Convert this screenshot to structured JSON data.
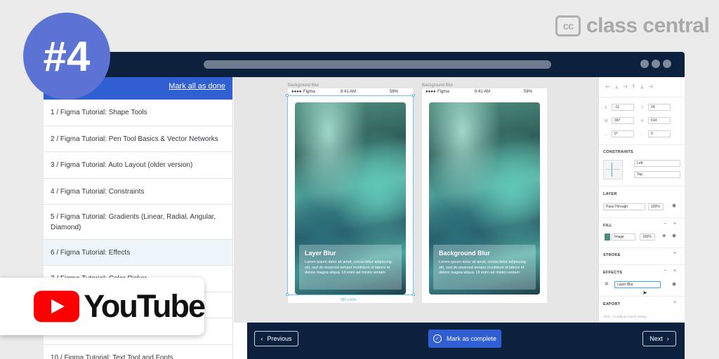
{
  "badge": {
    "text": "#4"
  },
  "brand": {
    "mark": "cc",
    "name": "class central"
  },
  "youtube": {
    "label": "YouTube"
  },
  "sidebar": {
    "mark_all": "Mark all as done",
    "lessons": [
      {
        "label": "1 / Figma Tutorial: Shape Tools"
      },
      {
        "label": "2 / Figma Tutorial: Pen Tool Basics & Vector Networks"
      },
      {
        "label": "3 / Figma Tutorial: Auto Layout (older version)"
      },
      {
        "label": "4 / Figma Tutorial: Constraints"
      },
      {
        "label": "5 / Figma Tutorial: Gradients (Linear, Radial, Angular, Diamond)"
      },
      {
        "label": "6 / Figma Tutorial: Effects",
        "active": true
      },
      {
        "label": "7 / Figma Tutorial: Color Picker"
      },
      {
        "label": ""
      },
      {
        "label": ""
      },
      {
        "label": "10 / Figma Tutorial: Text Tool and Fonts"
      }
    ]
  },
  "canvas": {
    "frames": [
      {
        "label": "Background Blur",
        "carrier": "Figma",
        "time": "9:41 AM",
        "battery": "58%",
        "card_title": "Layer Blur",
        "card_body": "Lorem ipsum dolor sit amet, consectetur adipiscing elit, sed do eiusmod tempor incididunt ut labore et dolore magna aliqua. Ut enim ad minim veniam",
        "selection_size": "397 x 614"
      },
      {
        "label": "Background Blur",
        "carrier": "Figma",
        "time": "9:41 AM",
        "battery": "58%",
        "card_title": "Background Blur",
        "card_body": "Lorem ipsum dolor sit amet, consectetur adipiscing elit, sed do eiusmod tempor incididunt ut labore et dolore magna aliqua. Ut enim ad minim veniam"
      }
    ]
  },
  "panel": {
    "x_label": "X",
    "x": "-11",
    "y_label": "Y",
    "y": "24",
    "w_label": "W",
    "w": "397",
    "h_label": "H",
    "h": "614",
    "rotation": "0°",
    "radius": "0",
    "constraints_title": "CONSTRAINTS",
    "constraint_h": "Left",
    "constraint_v": "Top",
    "layer_title": "LAYER",
    "blend_mode": "Pass Through",
    "layer_opacity": "100%",
    "fill_title": "FILL",
    "fill_type": "Image",
    "fill_opacity": "100%",
    "stroke_title": "STROKE",
    "effects_title": "EFFECTS",
    "effect_type": "Layer Blur",
    "export_title": "EXPORT",
    "export_hint": "Click + to add an export setting"
  },
  "nav": {
    "previous": "Previous",
    "mark_complete": "Mark as complete",
    "next": "Next"
  }
}
